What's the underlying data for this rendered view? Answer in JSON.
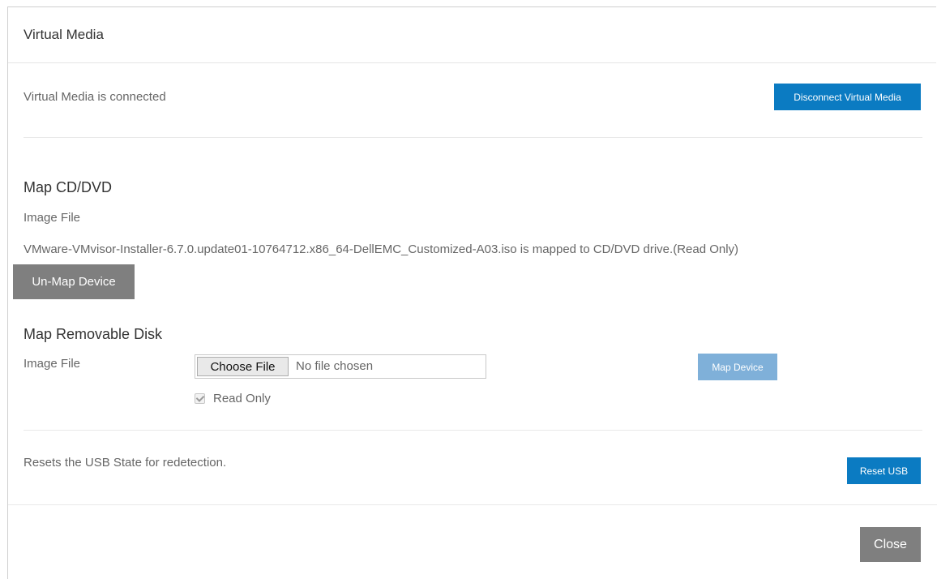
{
  "dialog": {
    "title": "Virtual Media"
  },
  "status": {
    "text": "Virtual Media is connected",
    "disconnect_label": "Disconnect Virtual Media"
  },
  "cd_dvd": {
    "title": "Map CD/DVD",
    "image_file_label": "Image File",
    "mapped_message": "VMware-VMvisor-Installer-6.7.0.update01-10764712.x86_64-DellEMC_Customized-A03.iso is mapped to CD/DVD drive.(Read Only)",
    "unmap_label": "Un-Map Device"
  },
  "removable_disk": {
    "title": "Map Removable Disk",
    "image_file_label": "Image File",
    "choose_file_label": "Choose File",
    "no_file_text": "No file chosen",
    "map_device_label": "Map Device",
    "read_only_label": "Read Only",
    "read_only_checked": true
  },
  "usb": {
    "text": "Resets the USB State for redetection.",
    "reset_label": "Reset USB"
  },
  "footer": {
    "close_label": "Close"
  },
  "colors": {
    "primary_button": "#0b7bc2",
    "disabled_button": "#7fb0d9",
    "grey_button": "#7f7f7f"
  }
}
